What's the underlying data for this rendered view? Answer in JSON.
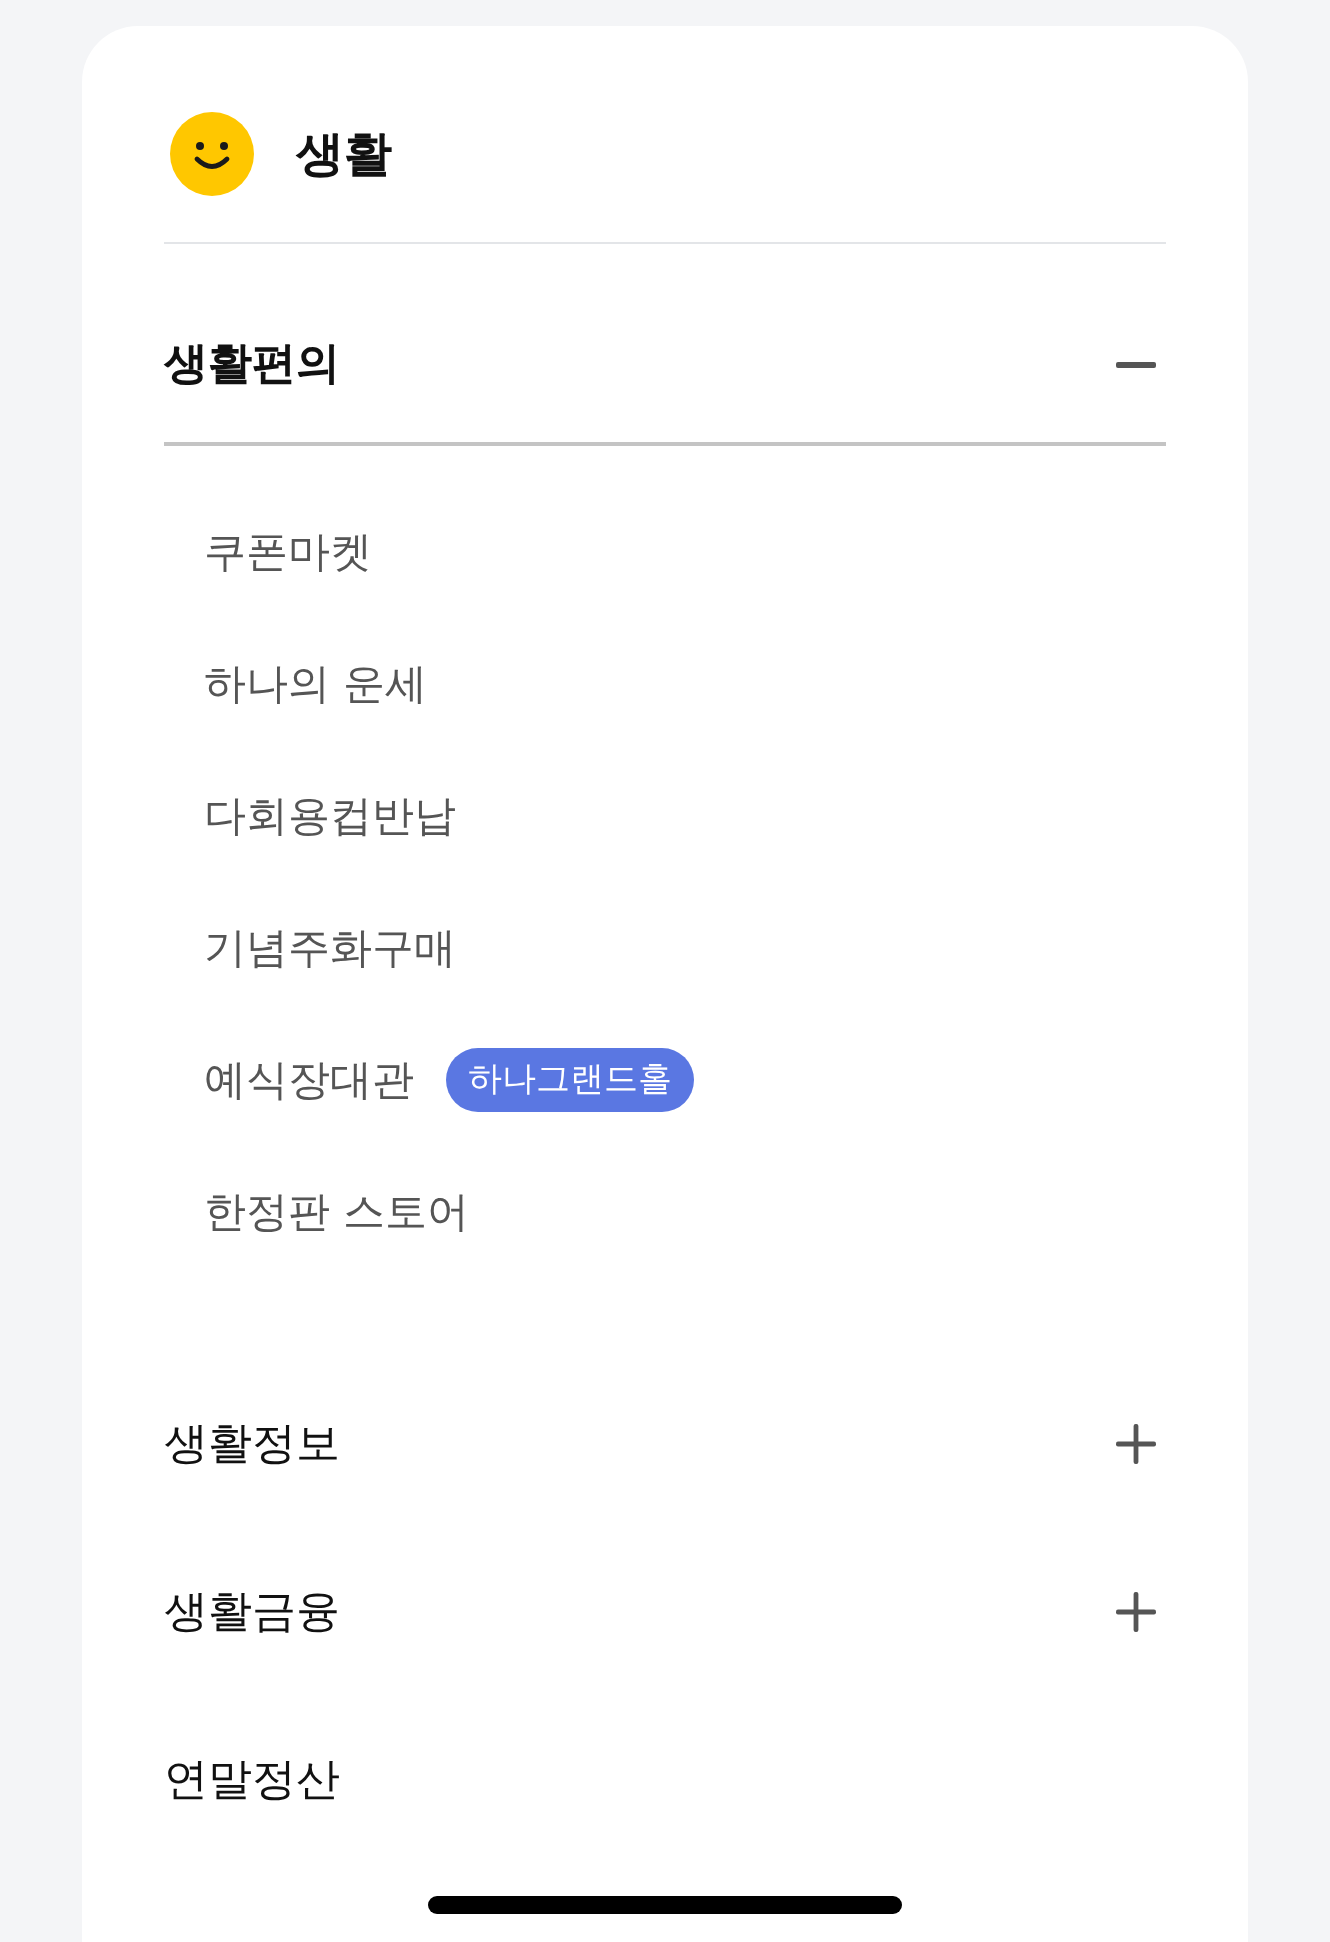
{
  "header": {
    "title": "생활"
  },
  "sections": [
    {
      "kind": "accordion",
      "title": "생활편의",
      "expanded": true,
      "items": [
        {
          "label": "쿠폰마켓"
        },
        {
          "label": "하나의 운세"
        },
        {
          "label": "다회용컵반납"
        },
        {
          "label": "기념주화구매"
        },
        {
          "label": "예식장대관",
          "badge": "하나그랜드홀"
        },
        {
          "label": "한정판 스토어"
        }
      ]
    },
    {
      "kind": "accordion",
      "title": "생활정보",
      "expanded": false
    },
    {
      "kind": "accordion",
      "title": "생활금융",
      "expanded": false
    },
    {
      "kind": "link",
      "title": "연말정산"
    }
  ]
}
